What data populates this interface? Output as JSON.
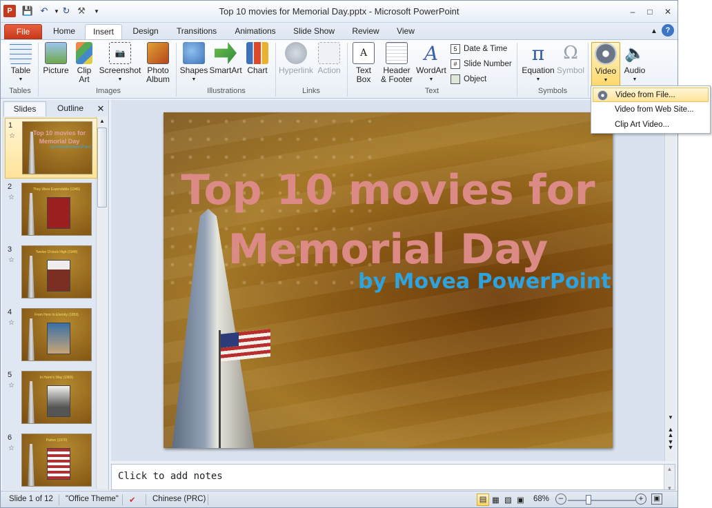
{
  "window": {
    "title": "Top 10 movies for Memorial Day.pptx - Microsoft PowerPoint",
    "app_icon": "P"
  },
  "qat": [
    "save-icon",
    "undo-icon",
    "redo-icon",
    "tools-icon",
    "customize-icon"
  ],
  "tabs": [
    {
      "label": "File"
    },
    {
      "label": "Home"
    },
    {
      "label": "Insert"
    },
    {
      "label": "Design"
    },
    {
      "label": "Transitions"
    },
    {
      "label": "Animations"
    },
    {
      "label": "Slide Show"
    },
    {
      "label": "Review"
    },
    {
      "label": "View"
    }
  ],
  "ribbon": {
    "table": "Table",
    "picture": "Picture",
    "clip_art": "Clip Art",
    "screenshot": "Screenshot",
    "photo_album": "Photo Album",
    "shapes": "Shapes",
    "smartart": "SmartArt",
    "chart": "Chart",
    "hyperlink": "Hyperlink",
    "action": "Action",
    "text_box": "Text Box",
    "header_footer": "Header & Footer",
    "wordart": "WordArt",
    "date_time": "Date & Time",
    "slide_number": "Slide Number",
    "object": "Object",
    "equation": "Equation",
    "symbol": "Symbol",
    "video": "Video",
    "audio": "Audio",
    "groups": {
      "tables": "Tables",
      "images": "Images",
      "illustrations": "Illustrations",
      "links": "Links",
      "text": "Text",
      "symbols": "Symbols"
    }
  },
  "dropdown": {
    "items": [
      {
        "label": "Video from File..."
      },
      {
        "label": "Video from Web Site..."
      },
      {
        "label": "Clip Art Video..."
      }
    ]
  },
  "panel": {
    "tab_slides": "Slides",
    "tab_outline": "Outline"
  },
  "thumbs": [
    {
      "num": "1",
      "caption": "Top 10 movies for Memorial Day",
      "sub": "by Movea PowerPoint"
    },
    {
      "num": "2",
      "caption": "They Were Expendable (1945)"
    },
    {
      "num": "3",
      "caption": "Twelve O'clock High (1949)"
    },
    {
      "num": "4",
      "caption": "From Here to Eternity (1953)"
    },
    {
      "num": "5",
      "caption": "In Harm's Way (1965)"
    },
    {
      "num": "6",
      "caption": "Patton (1970)"
    }
  ],
  "slide": {
    "title": "Top 10 movies for Memorial Day",
    "subtitle": "by Movea PowerPoint"
  },
  "notes": {
    "placeholder": "Click to add notes"
  },
  "status": {
    "slide": "Slide 1 of 12",
    "theme": "\"Office Theme\"",
    "language": "Chinese (PRC)",
    "zoom": "68%"
  }
}
